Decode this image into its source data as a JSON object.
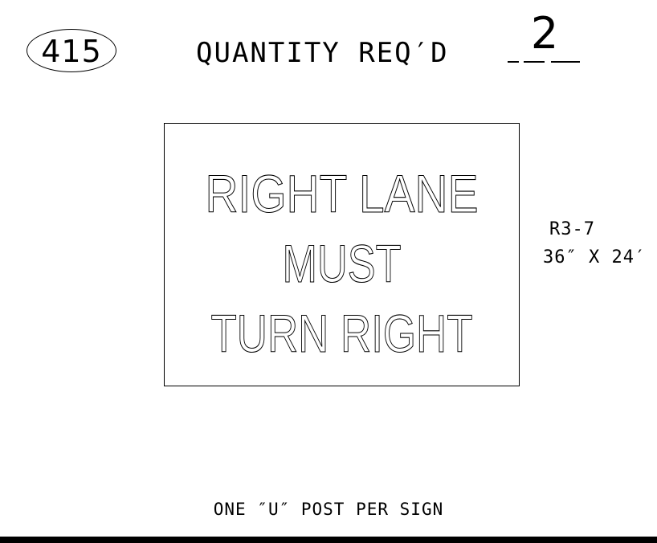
{
  "sheet_number": "415",
  "quantity": {
    "label": "QUANTITY REQ′D",
    "value": "2"
  },
  "sign": {
    "legend_lines": [
      "RIGHT LANE",
      "MUST",
      "TURN RIGHT"
    ],
    "code": "R3-7",
    "size": "36″ X 24′"
  },
  "note": "ONE ″U″ POST PER SIGN"
}
